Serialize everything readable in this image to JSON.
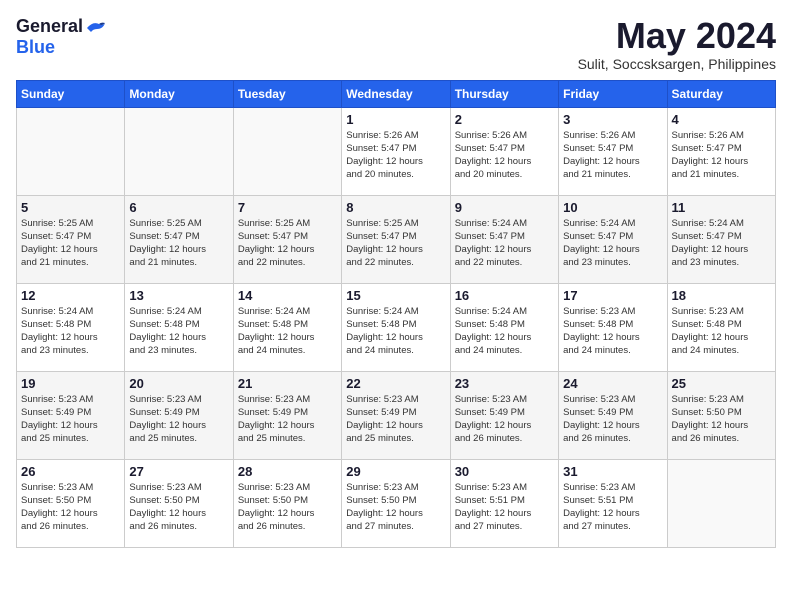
{
  "logo": {
    "general": "General",
    "blue": "Blue"
  },
  "title": "May 2024",
  "subtitle": "Sulit, Soccsksargen, Philippines",
  "days_header": [
    "Sunday",
    "Monday",
    "Tuesday",
    "Wednesday",
    "Thursday",
    "Friday",
    "Saturday"
  ],
  "weeks": [
    [
      {
        "day": "",
        "info": ""
      },
      {
        "day": "",
        "info": ""
      },
      {
        "day": "",
        "info": ""
      },
      {
        "day": "1",
        "info": "Sunrise: 5:26 AM\nSunset: 5:47 PM\nDaylight: 12 hours\nand 20 minutes."
      },
      {
        "day": "2",
        "info": "Sunrise: 5:26 AM\nSunset: 5:47 PM\nDaylight: 12 hours\nand 20 minutes."
      },
      {
        "day": "3",
        "info": "Sunrise: 5:26 AM\nSunset: 5:47 PM\nDaylight: 12 hours\nand 21 minutes."
      },
      {
        "day": "4",
        "info": "Sunrise: 5:26 AM\nSunset: 5:47 PM\nDaylight: 12 hours\nand 21 minutes."
      }
    ],
    [
      {
        "day": "5",
        "info": "Sunrise: 5:25 AM\nSunset: 5:47 PM\nDaylight: 12 hours\nand 21 minutes."
      },
      {
        "day": "6",
        "info": "Sunrise: 5:25 AM\nSunset: 5:47 PM\nDaylight: 12 hours\nand 21 minutes."
      },
      {
        "day": "7",
        "info": "Sunrise: 5:25 AM\nSunset: 5:47 PM\nDaylight: 12 hours\nand 22 minutes."
      },
      {
        "day": "8",
        "info": "Sunrise: 5:25 AM\nSunset: 5:47 PM\nDaylight: 12 hours\nand 22 minutes."
      },
      {
        "day": "9",
        "info": "Sunrise: 5:24 AM\nSunset: 5:47 PM\nDaylight: 12 hours\nand 22 minutes."
      },
      {
        "day": "10",
        "info": "Sunrise: 5:24 AM\nSunset: 5:47 PM\nDaylight: 12 hours\nand 23 minutes."
      },
      {
        "day": "11",
        "info": "Sunrise: 5:24 AM\nSunset: 5:47 PM\nDaylight: 12 hours\nand 23 minutes."
      }
    ],
    [
      {
        "day": "12",
        "info": "Sunrise: 5:24 AM\nSunset: 5:48 PM\nDaylight: 12 hours\nand 23 minutes."
      },
      {
        "day": "13",
        "info": "Sunrise: 5:24 AM\nSunset: 5:48 PM\nDaylight: 12 hours\nand 23 minutes."
      },
      {
        "day": "14",
        "info": "Sunrise: 5:24 AM\nSunset: 5:48 PM\nDaylight: 12 hours\nand 24 minutes."
      },
      {
        "day": "15",
        "info": "Sunrise: 5:24 AM\nSunset: 5:48 PM\nDaylight: 12 hours\nand 24 minutes."
      },
      {
        "day": "16",
        "info": "Sunrise: 5:24 AM\nSunset: 5:48 PM\nDaylight: 12 hours\nand 24 minutes."
      },
      {
        "day": "17",
        "info": "Sunrise: 5:23 AM\nSunset: 5:48 PM\nDaylight: 12 hours\nand 24 minutes."
      },
      {
        "day": "18",
        "info": "Sunrise: 5:23 AM\nSunset: 5:48 PM\nDaylight: 12 hours\nand 24 minutes."
      }
    ],
    [
      {
        "day": "19",
        "info": "Sunrise: 5:23 AM\nSunset: 5:49 PM\nDaylight: 12 hours\nand 25 minutes."
      },
      {
        "day": "20",
        "info": "Sunrise: 5:23 AM\nSunset: 5:49 PM\nDaylight: 12 hours\nand 25 minutes."
      },
      {
        "day": "21",
        "info": "Sunrise: 5:23 AM\nSunset: 5:49 PM\nDaylight: 12 hours\nand 25 minutes."
      },
      {
        "day": "22",
        "info": "Sunrise: 5:23 AM\nSunset: 5:49 PM\nDaylight: 12 hours\nand 25 minutes."
      },
      {
        "day": "23",
        "info": "Sunrise: 5:23 AM\nSunset: 5:49 PM\nDaylight: 12 hours\nand 26 minutes."
      },
      {
        "day": "24",
        "info": "Sunrise: 5:23 AM\nSunset: 5:49 PM\nDaylight: 12 hours\nand 26 minutes."
      },
      {
        "day": "25",
        "info": "Sunrise: 5:23 AM\nSunset: 5:50 PM\nDaylight: 12 hours\nand 26 minutes."
      }
    ],
    [
      {
        "day": "26",
        "info": "Sunrise: 5:23 AM\nSunset: 5:50 PM\nDaylight: 12 hours\nand 26 minutes."
      },
      {
        "day": "27",
        "info": "Sunrise: 5:23 AM\nSunset: 5:50 PM\nDaylight: 12 hours\nand 26 minutes."
      },
      {
        "day": "28",
        "info": "Sunrise: 5:23 AM\nSunset: 5:50 PM\nDaylight: 12 hours\nand 26 minutes."
      },
      {
        "day": "29",
        "info": "Sunrise: 5:23 AM\nSunset: 5:50 PM\nDaylight: 12 hours\nand 27 minutes."
      },
      {
        "day": "30",
        "info": "Sunrise: 5:23 AM\nSunset: 5:51 PM\nDaylight: 12 hours\nand 27 minutes."
      },
      {
        "day": "31",
        "info": "Sunrise: 5:23 AM\nSunset: 5:51 PM\nDaylight: 12 hours\nand 27 minutes."
      },
      {
        "day": "",
        "info": ""
      }
    ]
  ]
}
